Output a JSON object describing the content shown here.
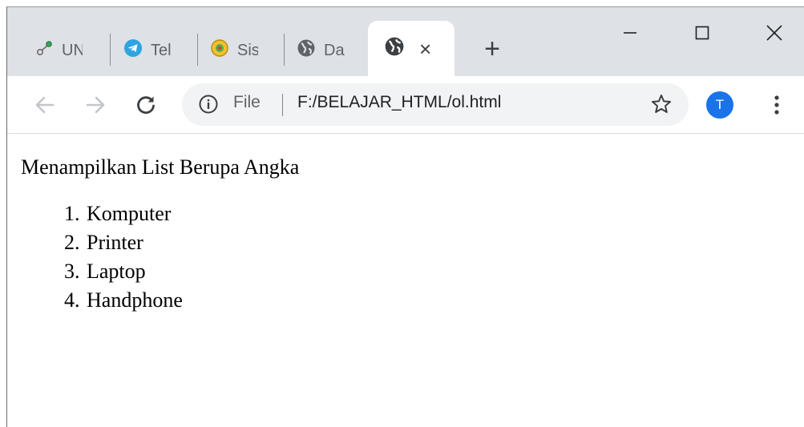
{
  "tabs": [
    {
      "label": "UN",
      "icon": "link-nodes-icon"
    },
    {
      "label": "Tel",
      "icon": "telegram-icon"
    },
    {
      "label": "Sis",
      "icon": "emblem-icon"
    },
    {
      "label": "Da",
      "icon": "globe-icon"
    }
  ],
  "active_tab": {
    "icon": "globe-icon",
    "close_label": "×"
  },
  "new_tab_label": "+",
  "address_bar": {
    "security_chip": "File",
    "url": "F:/BELAJAR_HTML/ol.html"
  },
  "profile_initial": "T",
  "colors": {
    "tabstrip": "#dee1e6",
    "accent": "#1a73e8"
  },
  "page": {
    "heading": "Menampilkan List Berupa Angka",
    "list_items": [
      "Komputer",
      "Printer",
      "Laptop",
      "Handphone"
    ]
  }
}
